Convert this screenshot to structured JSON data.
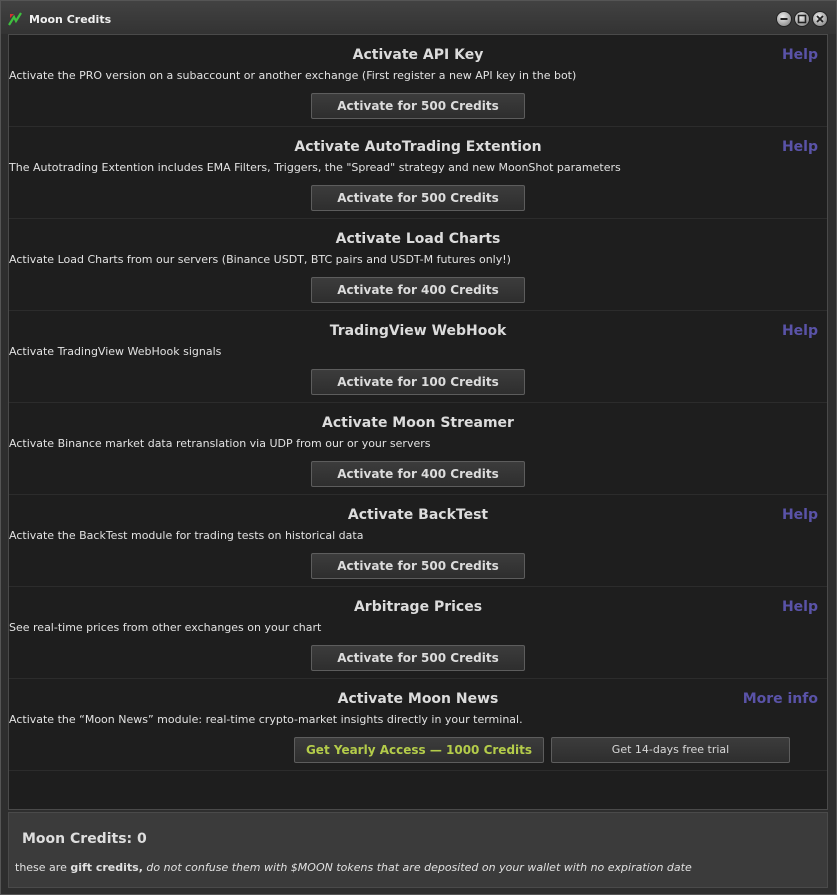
{
  "window": {
    "title": "Moon Credits",
    "icon": "moon-app-icon",
    "controls": [
      "minimize-icon",
      "maximize-icon",
      "close-icon"
    ]
  },
  "sections": [
    {
      "title": "Activate API Key",
      "help": "Help",
      "description": "Activate the PRO version on a subaccount or another exchange (First register a new API key in the bot)",
      "button": "Activate for 500 Credits"
    },
    {
      "title": "Activate AutoTrading Extention",
      "help": "Help",
      "description": "The Autotrading Extention includes EMA Filters, Triggers, the \"Spread\" strategy and new MoonShot parameters",
      "button": "Activate for 500 Credits"
    },
    {
      "title": "Activate Load Charts",
      "help": "",
      "description": "Activate Load Charts from our servers (Binance USDT, BTC pairs and USDT-M futures only!)",
      "button": "Activate for 400 Credits"
    },
    {
      "title": "TradingView WebHook",
      "help": "Help",
      "description": "Activate TradingView WebHook signals",
      "button": "Activate for 100 Credits"
    },
    {
      "title": "Activate Moon Streamer",
      "help": "",
      "description": "Activate Binance market data retranslation via UDP from our or your servers",
      "button": "Activate for 400 Credits"
    },
    {
      "title": "Activate BackTest",
      "help": "Help",
      "description": "Activate the BackTest module for trading tests on historical data",
      "button": "Activate for 500 Credits"
    },
    {
      "title": "Arbitrage Prices",
      "help": "Help",
      "description": "See real-time prices from other exchanges on your chart",
      "button": "Activate for 500 Credits"
    },
    {
      "title": "Activate Moon News",
      "help": "More info",
      "description": "Activate the “Moon News” module: real-time crypto-market insights directly in your terminal.",
      "button": "Get Yearly Access — 1000 Credits",
      "button2": "Get 14-days free trial"
    }
  ],
  "footer": {
    "credits_label": "Moon Credits: 0",
    "note_prefix": "these are ",
    "note_bold": "gift credits,",
    "note_italic": " do not confuse them with $MOON tokens that are deposited on your wallet with no expiration date"
  },
  "colors": {
    "help_link": "#5a53a8",
    "primary_button_text": "#b4cc4a",
    "panel_background": "#1e1e1e"
  }
}
